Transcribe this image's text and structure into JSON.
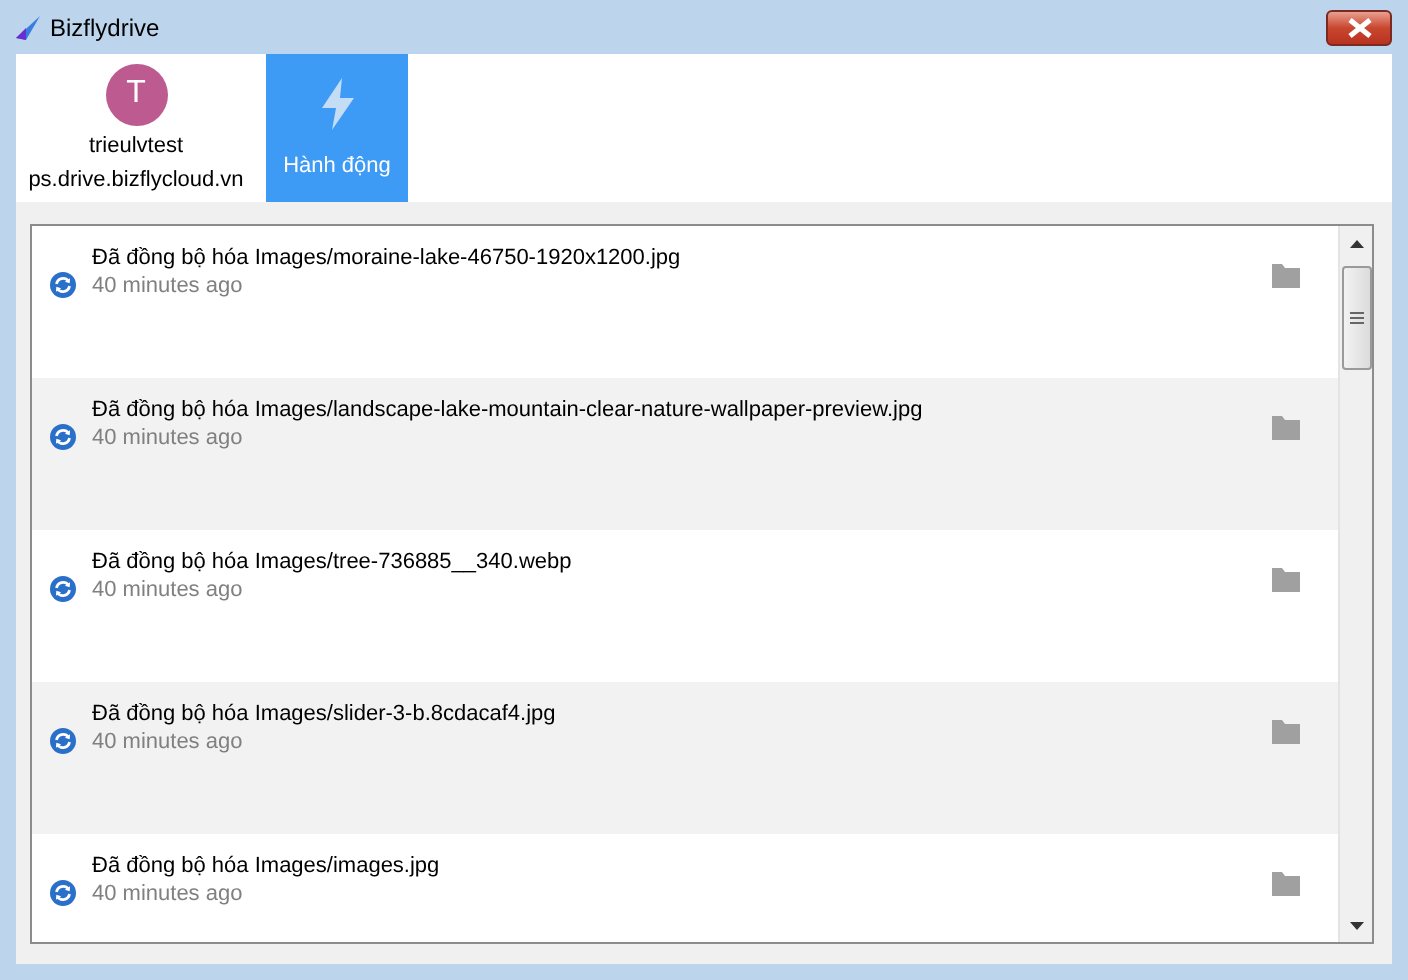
{
  "window": {
    "title": "Bizflydrive"
  },
  "account": {
    "avatar_letter": "T",
    "username": "trieulvtest",
    "server": "ps.drive.bizflycloud.vn"
  },
  "tabs": [
    {
      "label": "Hành động",
      "selected": true
    }
  ],
  "activities": [
    {
      "message": "Đã đồng bộ hóa Images/moraine-lake-46750-1920x1200.jpg",
      "time": "40 minutes ago"
    },
    {
      "message": "Đã đồng bộ hóa Images/landscape-lake-mountain-clear-nature-wallpaper-preview.jpg",
      "time": "40 minutes ago"
    },
    {
      "message": "Đã đồng bộ hóa Images/tree-736885__340.webp",
      "time": "40 minutes ago"
    },
    {
      "message": "Đã đồng bộ hóa Images/slider-3-b.8cdacaf4.jpg",
      "time": "40 minutes ago"
    },
    {
      "message": "Đã đồng bộ hóa Images/images.jpg",
      "time": "40 minutes ago"
    }
  ]
}
